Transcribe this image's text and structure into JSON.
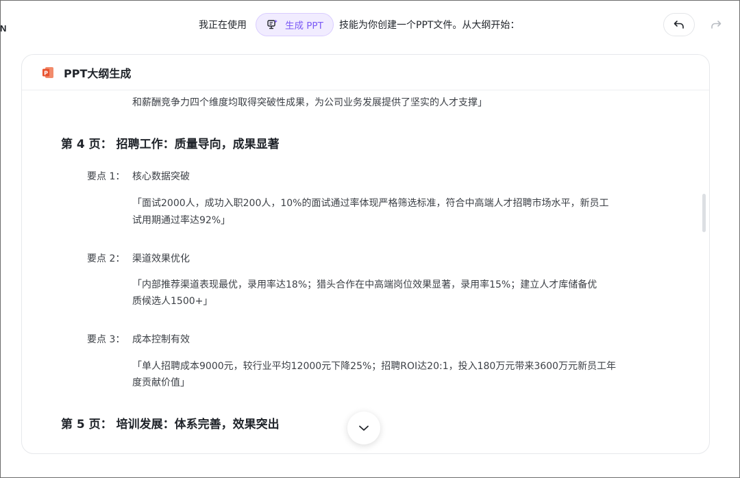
{
  "edge_text": "N",
  "prompt": {
    "pre_text": "我正在使用",
    "skill_label": "生成 PPT",
    "post_text": "技能为你创建一个PPT文件。从大纲开始："
  },
  "card": {
    "title": "PPT大纲生成",
    "top_fragment": "和薪酬竞争力四个维度均取得突破性成果，为公司业务发展提供了坚实的人才支撑」",
    "page4": {
      "heading": "第 4 页：  招聘工作：质量导向，成果显著",
      "points": [
        {
          "label": "要点 1：",
          "title": "核心数据突破",
          "line1": "「面试2000人，成功入职200人，10%的面试通过率体现严格筛选标准，符合中高端人才招聘市场水平，新员工",
          "line2": "试用期通过率达92%」"
        },
        {
          "label": "要点 2：",
          "title": "渠道效果优化",
          "line1": "「内部推荐渠道表现最优，录用率达18%；猎头合作在中高端岗位效果显著，录用率15%；建立人才库储备优",
          "line2": "质候选人1500+」"
        },
        {
          "label": "要点 3：",
          "title": "成本控制有效",
          "line1": "「单人招聘成本9000元，较行业平均12000元下降25%；招聘ROI达20:1，投入180万元带来3600万元新员工年",
          "line2": "度贡献价值」"
        }
      ]
    },
    "page5": {
      "heading": "第 5 页：  培训发展：体系完善，效果突出"
    }
  },
  "icons": {
    "skill": "presentation-skill-icon",
    "undo": "undo-icon",
    "redo": "redo-icon",
    "ppt": "powerpoint-file-icon",
    "scroll_down": "chevron-down-icon"
  },
  "colors": {
    "accent": "#7b5af5",
    "chip_bg": "#f1ecff",
    "ppt_orange": "#e8532f"
  }
}
